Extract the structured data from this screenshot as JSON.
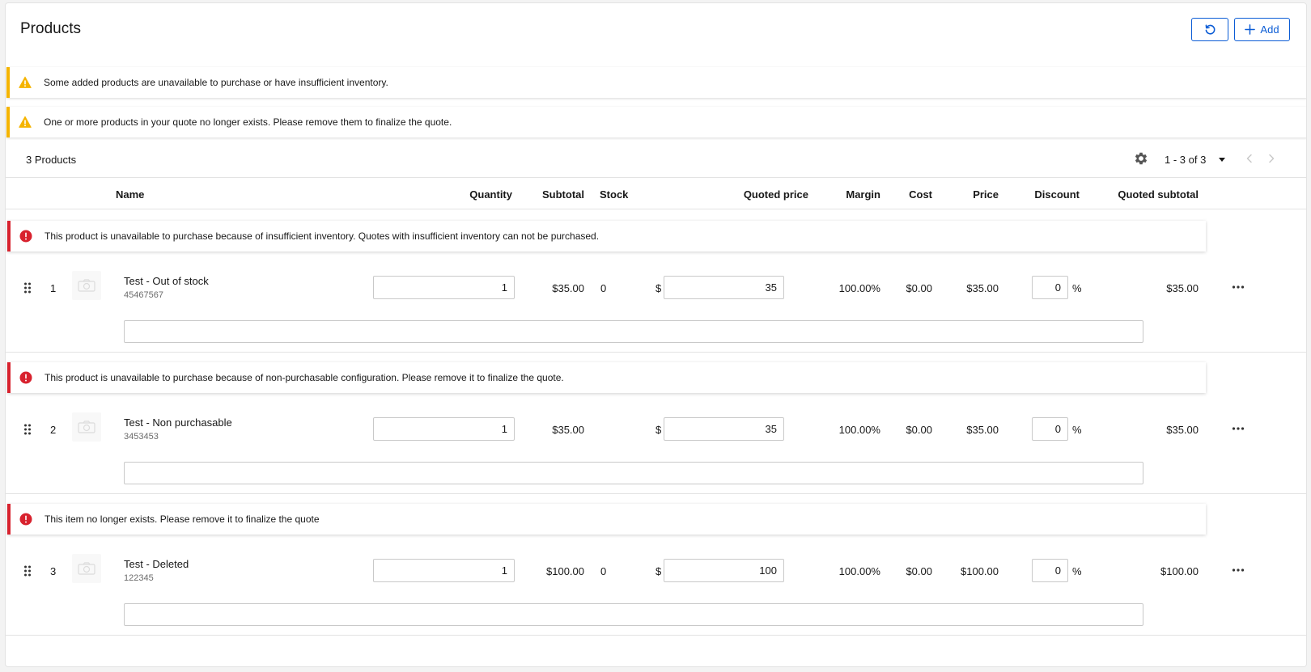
{
  "header": {
    "title": "Products",
    "add_label": "Add"
  },
  "warnings": [
    "Some added products are unavailable to purchase or have insufficient inventory.",
    "One or more products in your quote no longer exists. Please remove them to finalize the quote."
  ],
  "toolbar": {
    "count": "3 Products",
    "pagination": "1 - 3 of 3"
  },
  "columns": {
    "name": "Name",
    "quantity": "Quantity",
    "subtotal": "Subtotal",
    "stock": "Stock",
    "quoted_price": "Quoted price",
    "margin": "Margin",
    "cost": "Cost",
    "price": "Price",
    "discount": "Discount",
    "quoted_subtotal": "Quoted subtotal"
  },
  "rows": [
    {
      "error": "This product is unavailable to purchase because of insufficient inventory. Quotes with insufficient inventory can not be purchased.",
      "index": "1",
      "name": "Test - Out of stock",
      "sku": "45467567",
      "quantity": "1",
      "subtotal": "$35.00",
      "stock": "0",
      "currency": "$",
      "quoted_price": "35",
      "margin": "100.00%",
      "cost": "$0.00",
      "price": "$35.00",
      "discount": "0",
      "percent": "%",
      "quoted_subtotal": "$35.00",
      "note": ""
    },
    {
      "error": "This product is unavailable to purchase because of non-purchasable configuration. Please remove it to finalize the quote.",
      "index": "2",
      "name": "Test - Non purchasable",
      "sku": "3453453",
      "quantity": "1",
      "subtotal": "$35.00",
      "stock": "",
      "currency": "$",
      "quoted_price": "35",
      "margin": "100.00%",
      "cost": "$0.00",
      "price": "$35.00",
      "discount": "0",
      "percent": "%",
      "quoted_subtotal": "$35.00",
      "note": ""
    },
    {
      "error": "This item no longer exists. Please remove it to finalize the quote",
      "index": "3",
      "name": "Test - Deleted",
      "sku": "122345",
      "quantity": "1",
      "subtotal": "$100.00",
      "stock": "0",
      "currency": "$",
      "quoted_price": "100",
      "margin": "100.00%",
      "cost": "$0.00",
      "price": "$100.00",
      "discount": "0",
      "percent": "%",
      "quoted_subtotal": "$100.00",
      "note": ""
    }
  ],
  "colors": {
    "accent": "#0b5cd5",
    "warning": "#f5b400",
    "error": "#d8222e"
  },
  "icons": {
    "refresh": "refresh-icon",
    "add": "plus-icon",
    "warning": "warning-icon",
    "error": "error-icon",
    "settings": "gear-icon",
    "caret": "caret-down-icon",
    "prev": "chevron-left-icon",
    "next": "chevron-right-icon",
    "drag": "drag-handle-icon",
    "image": "camera-icon",
    "more": "more-icon"
  }
}
